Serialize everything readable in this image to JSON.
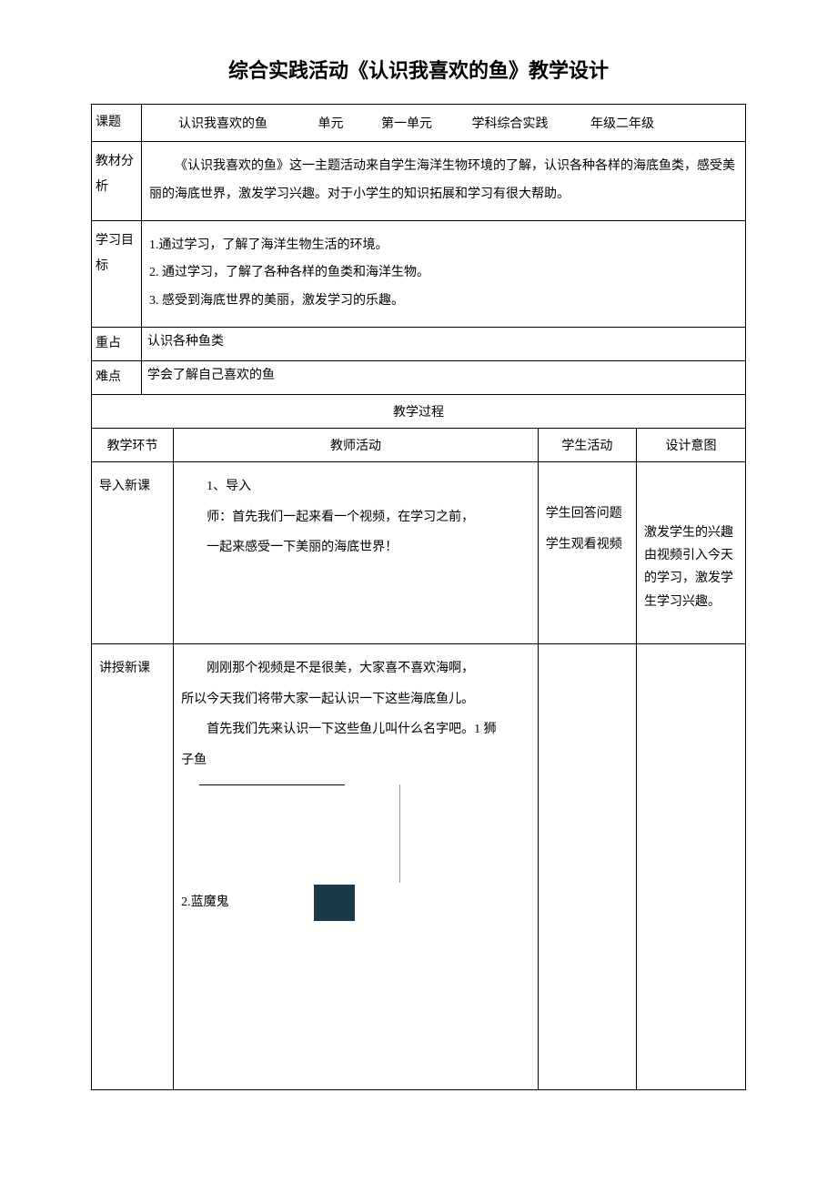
{
  "title": "综合实践活动《认识我喜欢的鱼》教学设计",
  "row1": {
    "l1": "课题",
    "v1": "认识我喜欢的鱼",
    "l2": "单元",
    "v2": "第一单元",
    "l3": "学科综合实践",
    "l4": "年级二年级"
  },
  "analysis": {
    "label": "教材分析",
    "text": "《认识我喜欢的鱼》这一主题活动来自学生海洋生物环境的了解，认识各种各样的海底鱼类，感受美丽的海底世界，激发学习兴趣。对于小学生的知识拓展和学习有很大帮助。"
  },
  "goals": {
    "label": "学习目标",
    "g1": "1.通过学习，了解了海洋生物生活的环境。",
    "g2": "2. 通过学习，了解了各种各样的鱼类和海洋生物。",
    "g3": "3. 感受到海底世界的美丽，激发学习的乐趣。"
  },
  "keypoint": {
    "label": "重占",
    "text": "认识各种鱼类"
  },
  "difficulty": {
    "label": "难点",
    "text": "学会了解自己喜欢的鱼"
  },
  "process_header": "教学过程",
  "cols": {
    "env": "教学环节",
    "teacher": "教师活动",
    "student": "学生活动",
    "intent": "设计意图"
  },
  "intro": {
    "env": "导入新课",
    "t1": "1、导入",
    "t2": "师：首先我们一起来看一个视频，在学习之前，",
    "t3": "一起来感受一下美丽的海底世界！",
    "s1": "学生回答问题",
    "s2": "学生观看视频",
    "i1": "激发学生的兴趣",
    "i2": "由视频引入今天的学习，激发学生学习兴趣。"
  },
  "teach": {
    "env": "讲授新课",
    "t1": "刚刚那个视频是不是很美，大家喜不喜欢海啊，",
    "t2": "所以今天我们将带大家一起认识一下这些海底鱼儿。",
    "t3": "首先我们先来认识一下这些鱼儿叫什么名字吧。1 狮",
    "t4": "子鱼",
    "t5": "2.蓝魔鬼"
  }
}
